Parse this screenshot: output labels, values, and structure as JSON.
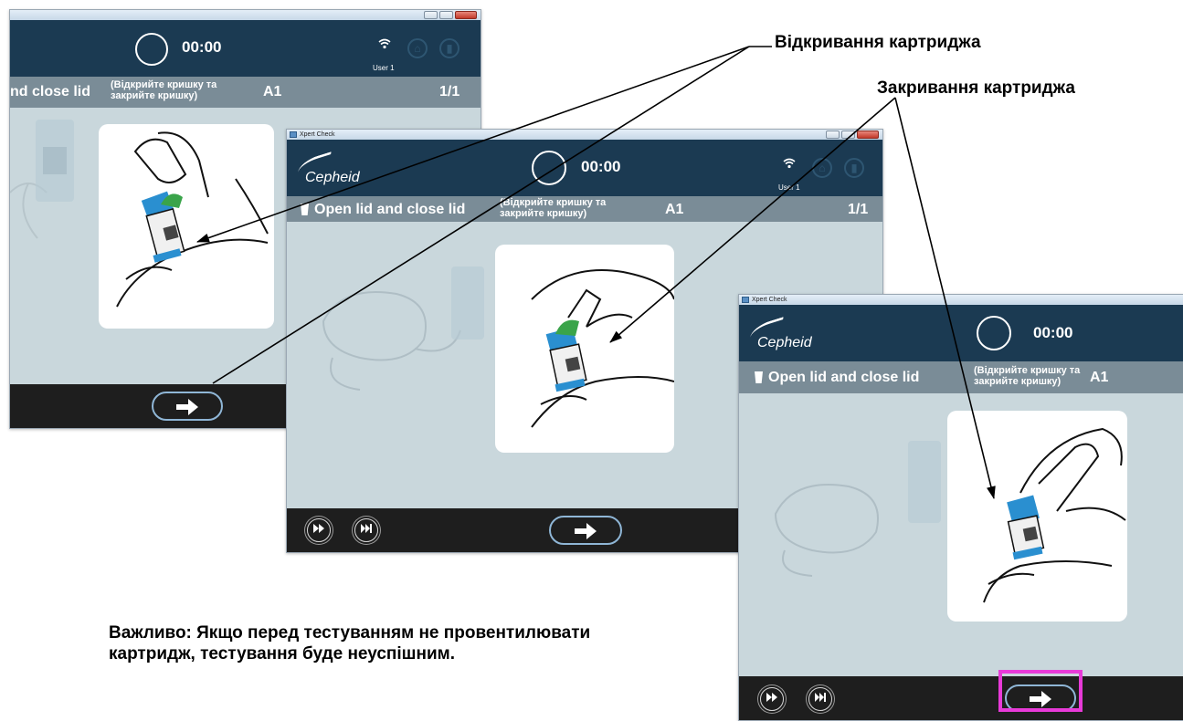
{
  "windows": [
    {
      "title": "",
      "timer": "00:00",
      "user": "User 1",
      "step_main": "nd close lid",
      "step_sub_line1": "(Відкрийте кришку та",
      "step_sub_line2": "закрийте кришку)",
      "step_position": "A1",
      "step_count": "1/1"
    },
    {
      "title": "Xpert Check",
      "brand": "Cepheid",
      "timer": "00:00",
      "user": "User 1",
      "step_main": "Open lid and close lid",
      "step_sub_line1": "(Відкрийте кришку та",
      "step_sub_line2": "закрийте кришку)",
      "step_position": "A1",
      "step_count": "1/1"
    },
    {
      "title": "Xpert Check",
      "brand": "Cepheid",
      "timer": "00:00",
      "step_main": "Open lid and close lid",
      "step_sub_line1": "(Відкрийте кришку та",
      "step_sub_line2": "закрийте кришку)",
      "step_position": "A1"
    }
  ],
  "annotations": {
    "open_cartridge": "Відкривання картриджа",
    "close_cartridge": "Закривання картриджа"
  },
  "note_line1": "Важливо: Якщо перед тестуванням не провентилювати",
  "note_line2": "картридж, тестування буде неуспішним.",
  "icons": {
    "next": "right-arrow-icon",
    "fast_forward": "fast-forward-icon",
    "skip_end": "skip-to-end-icon",
    "wifi": "wifi-icon",
    "timer": "timer-circle-icon"
  },
  "colors": {
    "header": "#1b3a52",
    "step_bar": "#7a8c97",
    "body": "#c9d7dc",
    "footer": "#1e1e1e",
    "cartridge_blue": "#2a8fd0",
    "lid_green": "#3aa44a",
    "highlight": "#e83ad8"
  }
}
